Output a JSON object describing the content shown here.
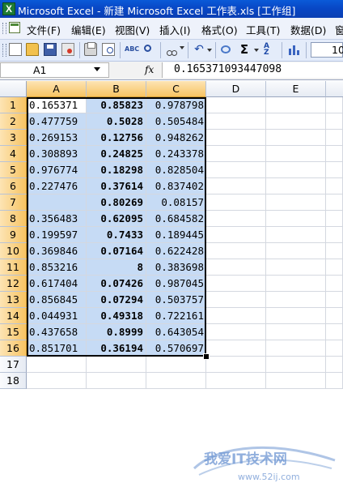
{
  "window": {
    "title": "Microsoft Excel - 新建 Microsoft Excel 工作表.xls  [工作组]",
    "app_icon": "excel-icon"
  },
  "menu": {
    "items": [
      "文件(F)",
      "编辑(E)",
      "视图(V)",
      "插入(I)",
      "格式(O)",
      "工具(T)",
      "数据(D)",
      "窗"
    ]
  },
  "toolbar": {
    "font_size_fragment": "10",
    "icons": [
      "new-icon",
      "open-icon",
      "save-icon",
      "permission-icon",
      "print-icon",
      "print-preview-icon",
      "spelling-icon",
      "cut-icon",
      "undo-icon",
      "hyperlink-icon",
      "autosum-icon",
      "sort-ascending-icon",
      "chart-icon"
    ],
    "sigma": "Σ"
  },
  "formula_bar": {
    "name_box": "A1",
    "fx": "fx",
    "content": "0.165371093447098"
  },
  "columns": [
    "A",
    "B",
    "C",
    "D",
    "E"
  ],
  "rows": [
    "1",
    "2",
    "3",
    "4",
    "5",
    "6",
    "7",
    "8",
    "9",
    "10",
    "11",
    "12",
    "13",
    "14",
    "15",
    "16",
    "17",
    "18"
  ],
  "cells": [
    {
      "a": "0.165371",
      "b": "0.85823",
      "c": "0.978798"
    },
    {
      "a": "0.477759",
      "b": "0.5028",
      "c": "0.505484"
    },
    {
      "a": "0.269153",
      "b": "0.12756",
      "c": "0.948262"
    },
    {
      "a": "0.308893",
      "b": "0.24825",
      "c": "0.243378"
    },
    {
      "a": "0.976774",
      "b": "0.18298",
      "c": "0.828504"
    },
    {
      "a": "0.227476",
      "b": "0.37614",
      "c": "0.837402"
    },
    {
      "a": "",
      "b": "0.80269",
      "c": "0.08157"
    },
    {
      "a": "0.356483",
      "b": "0.62095",
      "c": "0.684582"
    },
    {
      "a": "0.199597",
      "b": "0.7433",
      "c": "0.189445"
    },
    {
      "a": "0.369846",
      "b": "0.07164",
      "c": "0.622428"
    },
    {
      "a": "0.853216",
      "b": "8",
      "c": "0.383698"
    },
    {
      "a": "0.617404",
      "b": "0.07426",
      "c": "0.987045"
    },
    {
      "a": "0.856845",
      "b": "0.07294",
      "c": "0.503757"
    },
    {
      "a": "0.044931",
      "b": "0.49318",
      "c": "0.722161"
    },
    {
      "a": "0.437658",
      "b": "0.8999",
      "c": "0.643054"
    },
    {
      "a": "0.851701",
      "b": "0.36194",
      "c": "0.570697"
    }
  ],
  "selection": {
    "range": "A1:C16",
    "active": "A1"
  },
  "watermark": {
    "text": "我爱IT技术网",
    "url": "www.52ij.com"
  },
  "colors": {
    "selection": "#c6dbf5",
    "header_selected": "#f7c463",
    "title_bar": "#0846c4"
  }
}
